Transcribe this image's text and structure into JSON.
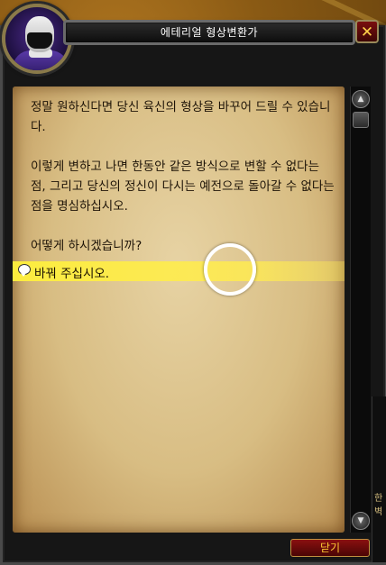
{
  "window": {
    "title": "에테리얼 형상변환가",
    "close_symbol": "✕"
  },
  "portrait": {
    "icon": "ethereal-npc-portrait"
  },
  "gossip": {
    "paragraphs": [
      "정말 원하신다면 당신 육신의 형상을 바꾸어 드릴 수 있습니다.",
      "이렇게 변하고 나면 한동안 같은 방식으로 변할 수 없다는 점, 그리고 당신의 정신이 다시는 예전으로 돌아갈 수 없다는 점을 명심하십시오.",
      "어떻게 하시겠습니까?"
    ],
    "options": [
      {
        "label": "바꿔 주십시오.",
        "icon": "chat-bubble-icon"
      }
    ]
  },
  "scrollbar": {
    "up_symbol": "▲",
    "down_symbol": "▼"
  },
  "footer": {
    "close_label": "닫기"
  },
  "side_strip": {
    "text": "한\n벽"
  },
  "colors": {
    "parchment": "#d8bd83",
    "highlight": "#fff03c",
    "title_text": "#ffffff",
    "button_text": "#ffcc33"
  }
}
